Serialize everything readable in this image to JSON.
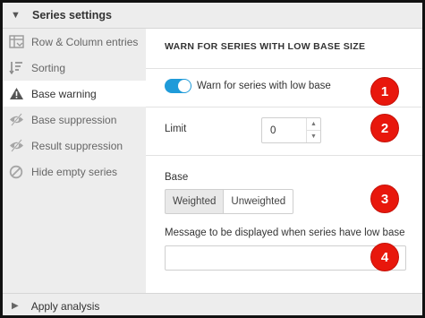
{
  "header": {
    "title": "Series settings",
    "caret_icon": "triangle-down-icon"
  },
  "sidebar": {
    "items": [
      {
        "label": "Row & Column entries",
        "icon": "row-column-icon",
        "active": false
      },
      {
        "label": "Sorting",
        "icon": "sort-icon",
        "active": false
      },
      {
        "label": "Base warning",
        "icon": "warning-icon",
        "active": true
      },
      {
        "label": "Base suppression",
        "icon": "eye-slash-icon",
        "active": false
      },
      {
        "label": "Result suppression",
        "icon": "eye-slash-icon",
        "active": false
      },
      {
        "label": "Hide empty series",
        "icon": "ban-icon",
        "active": false
      }
    ]
  },
  "main": {
    "section_title": "WARN FOR SERIES WITH LOW BASE SIZE",
    "toggle": {
      "label": "Warn for series with low base",
      "on": true
    },
    "limit": {
      "label": "Limit",
      "value": "0"
    },
    "base": {
      "label": "Base",
      "options": [
        "Weighted",
        "Unweighted"
      ],
      "selected": "Weighted"
    },
    "message": {
      "label": "Message to be displayed when series have low base",
      "value": ""
    }
  },
  "badges": [
    "1",
    "2",
    "3",
    "4"
  ],
  "footer": {
    "label": "Apply analysis",
    "caret_icon": "triangle-right-icon"
  },
  "colors": {
    "accent": "#1f9bd9",
    "badge": "#e8170c",
    "panel": "#ededed"
  }
}
